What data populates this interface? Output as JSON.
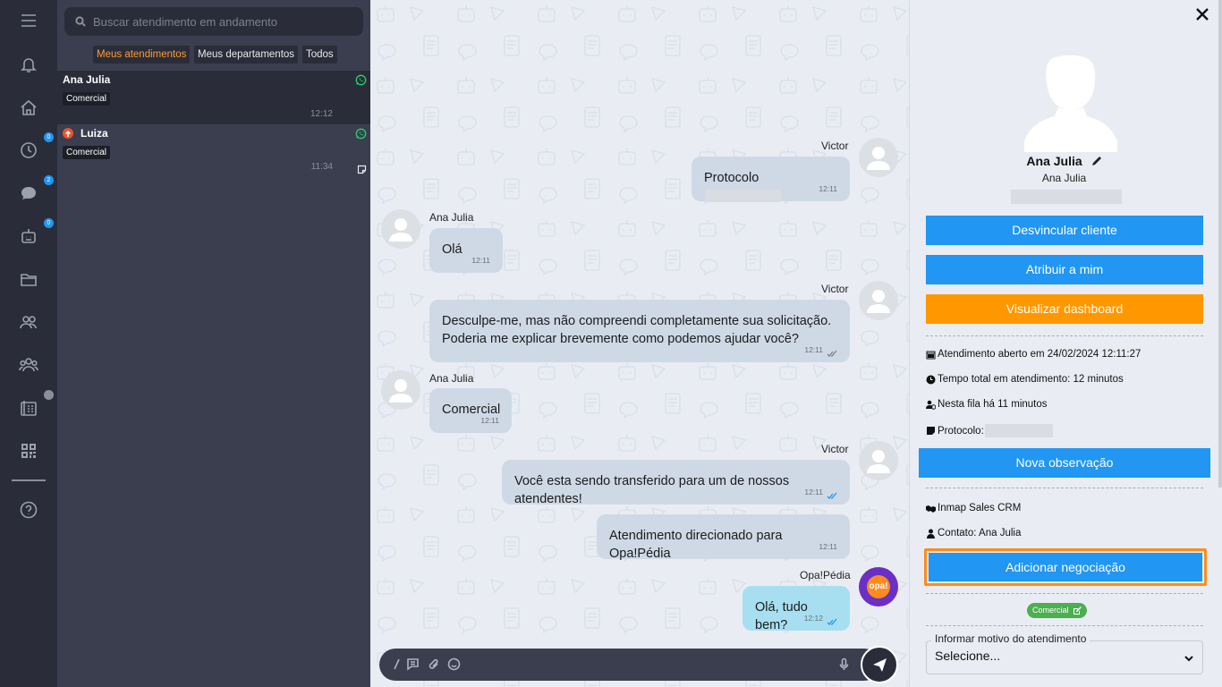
{
  "search": {
    "placeholder": "Buscar atendimento em andamento"
  },
  "filters": [
    "Meus atendimentos",
    "Meus departamentos",
    "Todos"
  ],
  "rail": {
    "badges": {
      "history": "0",
      "chats": "2",
      "bots": "0"
    }
  },
  "conversations": [
    {
      "name": "Ana Julia",
      "tag": "Comercial",
      "time": "12:12"
    },
    {
      "name": "Luiza",
      "tag": "Comercial",
      "time": "11:34"
    }
  ],
  "messages": [
    {
      "sender": "Victor",
      "text": "Protocolo",
      "time": "12:11"
    },
    {
      "sender": "Ana Julia",
      "text": "Olá",
      "time": "12:11"
    },
    {
      "sender": "Victor",
      "text_line1": "Desculpe-me, mas não compreendi completamente sua solicitação.",
      "text_line2": "Poderia me explicar brevemente como podemos ajudar você?",
      "time": "12:11"
    },
    {
      "sender": "Ana Julia",
      "text": "Comercial",
      "time": "12:11"
    },
    {
      "sender": "Victor",
      "text": "Você esta sendo transferido para um de nossos atendentes!",
      "time": "12:11"
    },
    {
      "text": "Atendimento direcionado para Opa!Pédia",
      "time": "12:11"
    },
    {
      "sender": "Opa!Pédia",
      "text": "Olá, tudo bem?",
      "time": "12:12"
    }
  ],
  "bot_avatar_label": "opa!",
  "contact": {
    "name": "Ana Julia",
    "subtitle": "Ana Julia"
  },
  "buttons": {
    "unlink": "Desvincular cliente",
    "assign": "Atribuir a mim",
    "dashboard": "Visualizar dashboard",
    "new_note": "Nova observação",
    "add_deal": "Adicionar negociação"
  },
  "info": {
    "opened": "Atendimento aberto em 24/02/2024 12:11:27",
    "total_time": "Tempo total em atendimento: 12 minutos",
    "queue_time": "Nesta fila há 11 minutos",
    "protocol_label": "Protocolo:",
    "crm": "Inmap Sales CRM",
    "contact_line": "Contato: Ana Julia"
  },
  "department_chip": "Comercial",
  "reason": {
    "label": "Informar motivo do atendimento",
    "value": "Selecione..."
  },
  "colors": {
    "accent_blue": "#2196f3",
    "accent_orange": "#ff9800",
    "active_filter": "#ff9a2e",
    "rail_bg": "#2a2d39"
  }
}
